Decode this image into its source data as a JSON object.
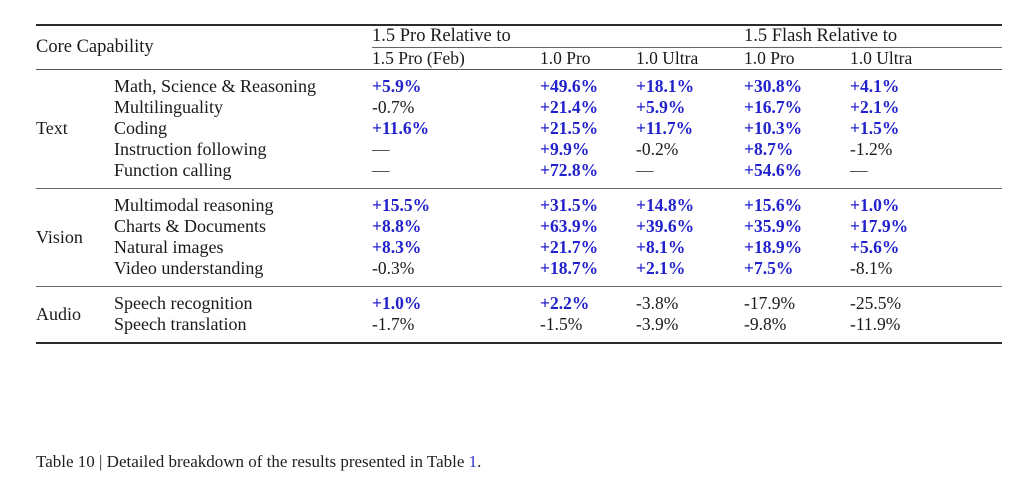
{
  "table": {
    "headers": {
      "core_capability": "Core Capability",
      "group_pro": "1.5 Pro Relative to",
      "group_flash": "1.5 Flash Relative to",
      "columns": [
        "1.5 Pro (Feb)",
        "1.0 Pro",
        "1.0 Ultra",
        "1.0 Pro",
        "1.0 Ultra"
      ]
    },
    "sections": [
      {
        "name": "Text",
        "rows": [
          {
            "capability": "Math, Science & Reasoning",
            "values": [
              "+5.9%",
              "+49.6%",
              "+18.1%",
              "+30.8%",
              "+4.1%"
            ]
          },
          {
            "capability": "Multilinguality",
            "values": [
              "-0.7%",
              "+21.4%",
              "+5.9%",
              "+16.7%",
              "+2.1%"
            ]
          },
          {
            "capability": "Coding",
            "values": [
              "+11.6%",
              "+21.5%",
              "+11.7%",
              "+10.3%",
              "+1.5%"
            ]
          },
          {
            "capability": "Instruction following",
            "values": [
              "—",
              "+9.9%",
              "-0.2%",
              "+8.7%",
              "-1.2%"
            ]
          },
          {
            "capability": "Function calling",
            "values": [
              "—",
              "+72.8%",
              "—",
              "+54.6%",
              "—"
            ]
          }
        ]
      },
      {
        "name": "Vision",
        "rows": [
          {
            "capability": "Multimodal reasoning",
            "values": [
              "+15.5%",
              "+31.5%",
              "+14.8%",
              "+15.6%",
              "+1.0%"
            ]
          },
          {
            "capability": "Charts & Documents",
            "values": [
              "+8.8%",
              "+63.9%",
              "+39.6%",
              "+35.9%",
              "+17.9%"
            ]
          },
          {
            "capability": "Natural images",
            "values": [
              "+8.3%",
              "+21.7%",
              "+8.1%",
              "+18.9%",
              "+5.6%"
            ]
          },
          {
            "capability": "Video understanding",
            "values": [
              "-0.3%",
              "+18.7%",
              "+2.1%",
              "+7.5%",
              "-8.1%"
            ]
          }
        ]
      },
      {
        "name": "Audio",
        "rows": [
          {
            "capability": "Speech recognition",
            "values": [
              "+1.0%",
              "+2.2%",
              "-3.8%",
              "-17.9%",
              "-25.5%"
            ]
          },
          {
            "capability": "Speech translation",
            "values": [
              "-1.7%",
              "-1.5%",
              "-3.9%",
              "-9.8%",
              "-11.9%"
            ]
          }
        ]
      }
    ]
  },
  "caption": {
    "prefix": "Table 10 | Detailed breakdown of the results presented in Table ",
    "reference": "1",
    "suffix": "."
  },
  "colors": {
    "positive": "#2222cc",
    "link": "#3333cc",
    "text": "#1a1a1a",
    "rule": "#2b2b2b"
  }
}
